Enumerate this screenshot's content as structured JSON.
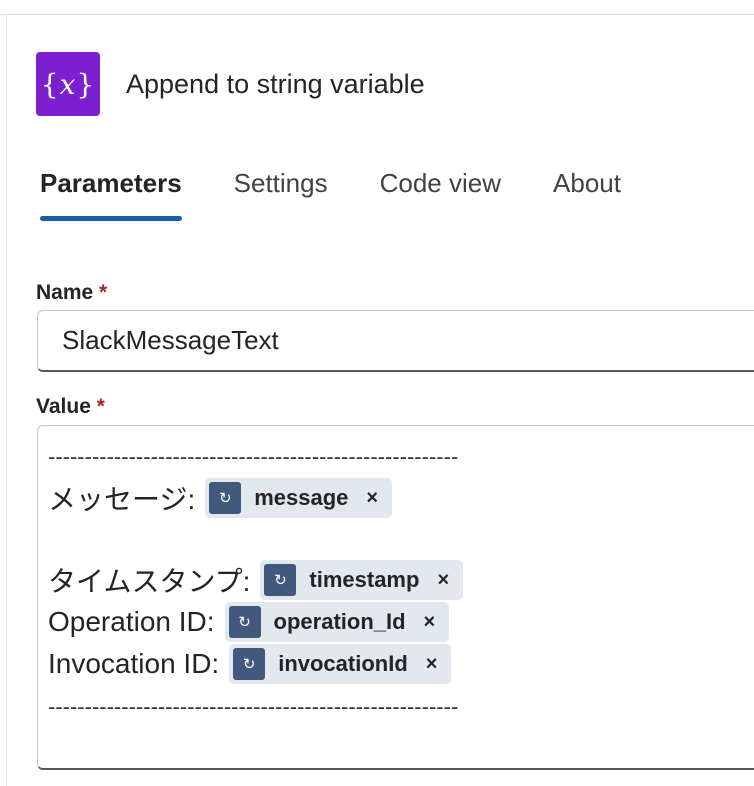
{
  "action": {
    "icon": "variable-icon",
    "icon_text": "{x}",
    "title": "Append to string variable",
    "accent_color": "#7b1fd0"
  },
  "tabs": [
    {
      "label": "Parameters",
      "active": true
    },
    {
      "label": "Settings",
      "active": false
    },
    {
      "label": "Code view",
      "active": false
    },
    {
      "label": "About",
      "active": false
    }
  ],
  "fields": {
    "name": {
      "label": "Name",
      "required_marker": "*",
      "value": "SlackMessageText"
    },
    "value": {
      "label": "Value",
      "required_marker": "*",
      "separator": "--------------------------------------------------------",
      "lines": [
        {
          "prefix": "メッセージ:",
          "token": "message"
        },
        {
          "prefix": "タイムスタンプ:",
          "token": "timestamp"
        },
        {
          "prefix": "Operation ID:",
          "token": "operation_Id"
        },
        {
          "prefix": "Invocation ID:",
          "token": "invocationId"
        }
      ],
      "token_icon": "dynamic-content-icon",
      "token_remove_glyph": "×",
      "token_icon_color": "#41597c"
    }
  }
}
